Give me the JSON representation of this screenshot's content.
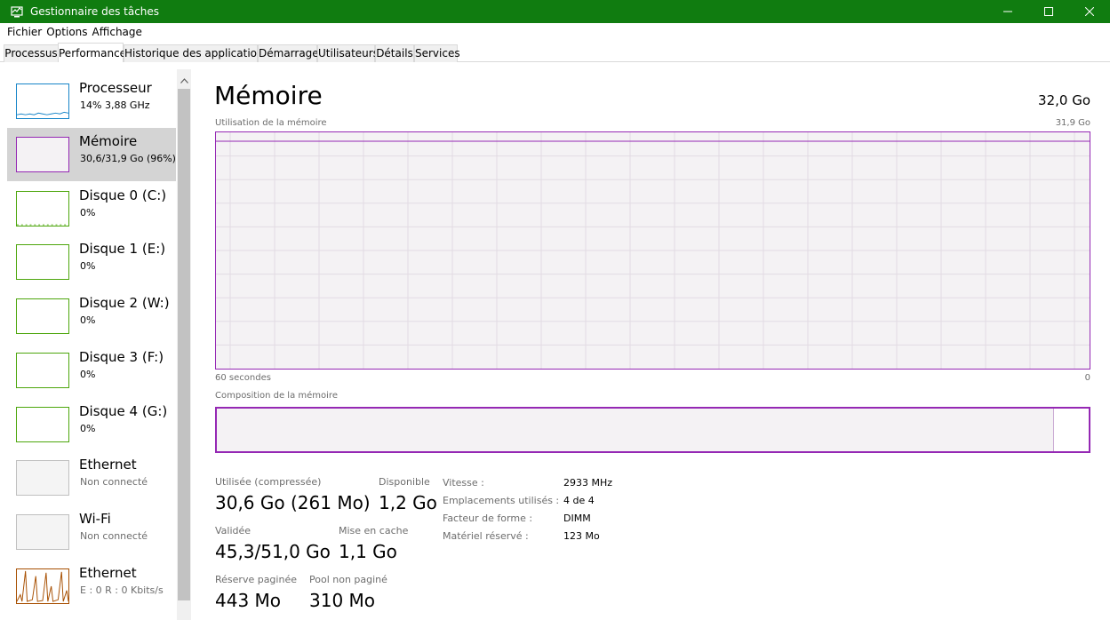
{
  "window": {
    "title": "Gestionnaire des tâches"
  },
  "menu": [
    "Fichier",
    "Options",
    "Affichage"
  ],
  "tabs": [
    "Processus",
    "Performance",
    "Historique des applications",
    "Démarrage",
    "Utilisateurs",
    "Détails",
    "Services"
  ],
  "active_tab": "Performance",
  "sidebar": {
    "items": [
      {
        "title": "Processeur",
        "sub": "14%  3,88 GHz"
      },
      {
        "title": "Mémoire",
        "sub": "30,6/31,9 Go (96%)"
      },
      {
        "title": "Disque 0 (C:)",
        "sub": "0%"
      },
      {
        "title": "Disque 1 (E:)",
        "sub": "0%"
      },
      {
        "title": "Disque 2 (W:)",
        "sub": "0%"
      },
      {
        "title": "Disque 3 (F:)",
        "sub": "0%"
      },
      {
        "title": "Disque 4 (G:)",
        "sub": "0%"
      },
      {
        "title": "Ethernet",
        "sub": "Non connecté"
      },
      {
        "title": "Wi-Fi",
        "sub": "Non connecté"
      },
      {
        "title": "Ethernet",
        "sub": "E : 0  R : 0 Kbits/s"
      }
    ]
  },
  "main": {
    "title": "Mémoire",
    "total": "32,0 Go",
    "graph_label": "Utilisation de la mémoire",
    "graph_max": "31,9 Go",
    "graph_time": "60 secondes",
    "graph_min": "0",
    "composition_label": "Composition de la mémoire",
    "composition_used_fraction": 0.96
  },
  "stats": {
    "used_label": "Utilisée (compressée)",
    "used_value": "30,6 Go (261 Mo)",
    "available_label": "Disponible",
    "available_value": "1,2 Go",
    "committed_label": "Validée",
    "committed_value": "45,3/51,0 Go",
    "cached_label": "Mise en cache",
    "cached_value": "1,1 Go",
    "paged_label": "Réserve paginée",
    "paged_value": "443 Mo",
    "nonpaged_label": "Pool non paginé",
    "nonpaged_value": "310 Mo"
  },
  "info": [
    {
      "label": "Vitesse :",
      "value": "2933 MHz"
    },
    {
      "label": "Emplacements utilisés :",
      "value": "4 de 4"
    },
    {
      "label": "Facteur de forme :",
      "value": "DIMM"
    },
    {
      "label": "Matériel réservé :",
      "value": "123 Mo"
    }
  ],
  "colors": {
    "titlebar": "#107c10",
    "memory_accent": "#9528b4",
    "cpu_accent": "#1785c8",
    "disk_accent": "#4da60c",
    "ethernet_accent": "#a74f01"
  }
}
